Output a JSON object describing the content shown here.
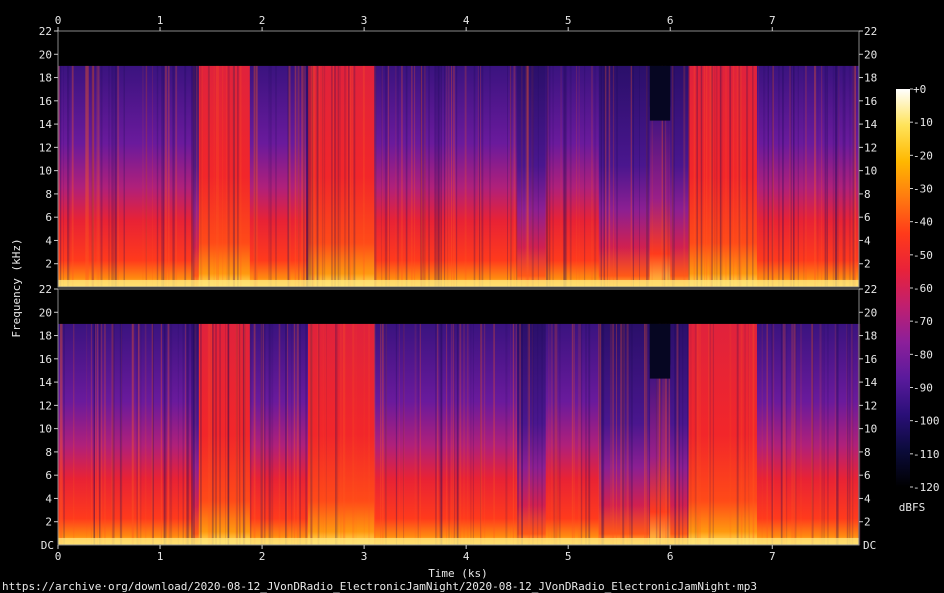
{
  "chart_data": {
    "type": "heatmap",
    "title": "",
    "xlabel": "Time (ks)",
    "ylabel": "Frequency (kHz)",
    "x_ticks": [
      "0",
      "1",
      "2",
      "3",
      "4",
      "5",
      "6",
      "7"
    ],
    "y_ticks": [
      "22",
      "20",
      "18",
      "16",
      "14",
      "12",
      "10",
      "8",
      "6",
      "4",
      "2"
    ],
    "y_bottom_tick": "DC",
    "xlim": [
      0,
      7.85
    ],
    "ylim": [
      0,
      22
    ],
    "channels": 2,
    "colorbar": {
      "label": "dBFS",
      "ticks": [
        "+0",
        "-10",
        "-20",
        "-30",
        "-40",
        "-50",
        "-60",
        "-70",
        "-80",
        "-90",
        "-100",
        "-110",
        "-120"
      ],
      "range": [
        -120,
        0
      ],
      "colors": [
        "#000000",
        "#0b0b3a",
        "#2a0f78",
        "#5a1a9c",
        "#8c1f9a",
        "#c01f6f",
        "#e8223a",
        "#ff3a1a",
        "#ff7a10",
        "#ffb800",
        "#ffe35a",
        "#ffffff"
      ]
    },
    "cutoff_khz": 19,
    "segments": [
      {
        "start": 0.0,
        "end": 1.32,
        "level": "mid"
      },
      {
        "start": 1.32,
        "end": 1.38,
        "level": "low"
      },
      {
        "start": 1.38,
        "end": 1.88,
        "level": "high"
      },
      {
        "start": 1.88,
        "end": 2.45,
        "level": "mid"
      },
      {
        "start": 2.45,
        "end": 3.1,
        "level": "high"
      },
      {
        "start": 3.1,
        "end": 4.5,
        "level": "mid"
      },
      {
        "start": 4.5,
        "end": 4.78,
        "level": "low"
      },
      {
        "start": 4.78,
        "end": 5.3,
        "level": "mid"
      },
      {
        "start": 5.3,
        "end": 5.8,
        "level": "low"
      },
      {
        "start": 5.8,
        "end": 6.0,
        "level": "gap"
      },
      {
        "start": 6.0,
        "end": 6.18,
        "level": "low"
      },
      {
        "start": 6.18,
        "end": 6.85,
        "level": "high"
      },
      {
        "start": 6.85,
        "end": 7.85,
        "level": "mid"
      }
    ]
  },
  "footer_url": "https://archive·org/download/2020-08-12_JVonDRadio_ElectronicJamNight/2020-08-12_JVonDRadio_ElectronicJamNight·mp3"
}
